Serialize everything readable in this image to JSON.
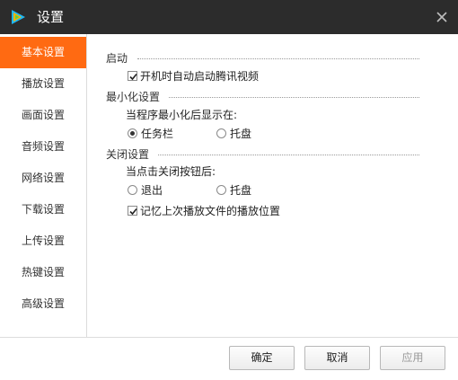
{
  "window": {
    "title": "设置"
  },
  "sidebar": {
    "items": [
      {
        "label": "基本设置",
        "active": true
      },
      {
        "label": "播放设置",
        "active": false
      },
      {
        "label": "画面设置",
        "active": false
      },
      {
        "label": "音频设置",
        "active": false
      },
      {
        "label": "网络设置",
        "active": false
      },
      {
        "label": "下载设置",
        "active": false
      },
      {
        "label": "上传设置",
        "active": false
      },
      {
        "label": "热键设置",
        "active": false
      },
      {
        "label": "高级设置",
        "active": false
      }
    ]
  },
  "startup": {
    "title": "启动",
    "autostart_label": "开机时自动启动腾讯视频",
    "autostart_checked": true
  },
  "minimize": {
    "title": "最小化设置",
    "prompt": "当程序最小化后显示在:",
    "options": [
      "任务栏",
      "托盘"
    ],
    "selected": "任务栏"
  },
  "close": {
    "title": "关闭设置",
    "prompt": "当点击关闭按钮后:",
    "options": [
      "退出",
      "托盘"
    ],
    "selected": null,
    "remember_label": "记忆上次播放文件的播放位置",
    "remember_checked": true
  },
  "footer": {
    "ok_label": "确定",
    "cancel_label": "取消",
    "apply_label": "应用",
    "apply_disabled": true
  },
  "colors": {
    "accent": "#ff6a12",
    "titlebar": "#2c2c2c"
  },
  "icons": {
    "app": "tencent-video-logo",
    "close": "close-icon"
  }
}
